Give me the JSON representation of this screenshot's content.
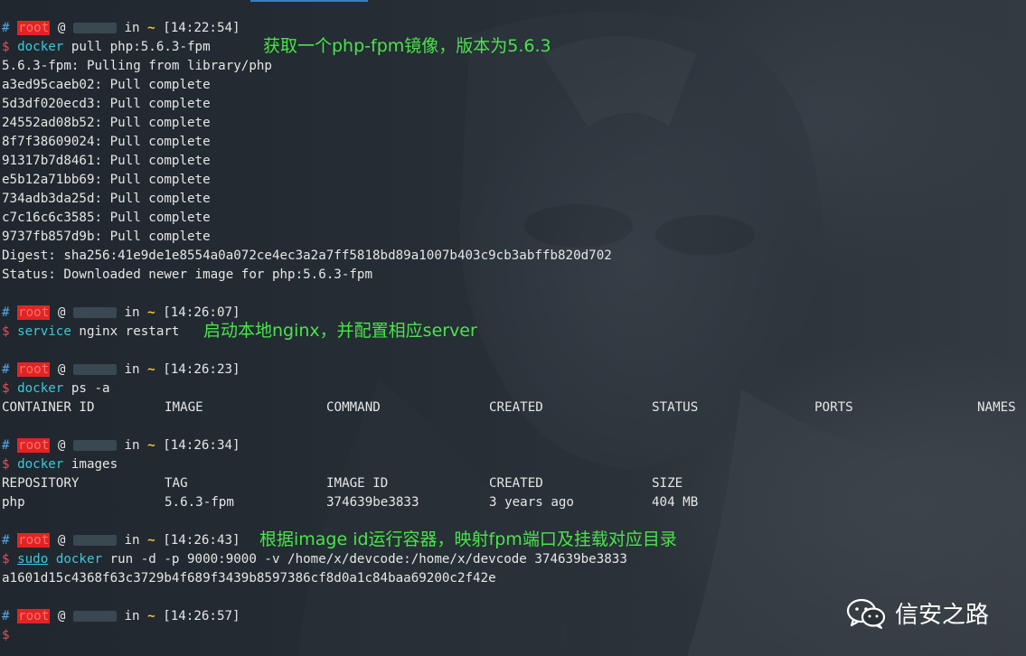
{
  "prompts": [
    {
      "user": "root",
      "time": "[14:22:54]"
    },
    {
      "user": "root",
      "time": "[14:26:07]"
    },
    {
      "user": "root",
      "time": "[14:26:23]"
    },
    {
      "user": "root",
      "time": "[14:26:34]"
    },
    {
      "user": "root",
      "time": "[14:26:43]"
    },
    {
      "user": "root",
      "time": "[14:26:57]"
    }
  ],
  "cmd1": {
    "cmd": "docker",
    "args": " pull php:5.6.3-fpm",
    "annotation": "获取一个php-fpm镜像，版本为5.6.3"
  },
  "pull_output": [
    "5.6.3-fpm: Pulling from library/php",
    "a3ed95caeb02: Pull complete",
    "5d3df020ecd3: Pull complete",
    "24552ad08b52: Pull complete",
    "8f7f38609024: Pull complete",
    "91317b7d8461: Pull complete",
    "e5b12a71bb69: Pull complete",
    "734adb3da25d: Pull complete",
    "c7c16c6c3585: Pull complete",
    "9737fb857d9b: Pull complete",
    "Digest: sha256:41e9de1e8554a0a072ce4ec3a2a7ff5818bd89a1007b403c9cb3abffb820d702",
    "Status: Downloaded newer image for php:5.6.3-fpm"
  ],
  "cmd2": {
    "cmd": "service",
    "args": " nginx restart",
    "annotation": "启动本地nginx，并配置相应server"
  },
  "cmd3": {
    "cmd": "docker",
    "args": " ps -a"
  },
  "ps_headers": [
    "CONTAINER ID",
    "IMAGE",
    "COMMAND",
    "CREATED",
    "STATUS",
    "PORTS",
    "NAMES"
  ],
  "cmd4": {
    "cmd": "docker",
    "args": " images"
  },
  "images_headers": [
    "REPOSITORY",
    "TAG",
    "IMAGE ID",
    "CREATED",
    "SIZE"
  ],
  "images_rows": [
    [
      "php",
      "5.6.3-fpm",
      "374639be3833",
      "3 years ago",
      "404 MB"
    ]
  ],
  "cmd5": {
    "sudo": "sudo",
    "cmd": "docker",
    "args": " run -d -p 9000:9000 -v /home/x/devcode:/home/x/devcode 374639be3833",
    "annotation": "根据image id运行容器，映射fpm端口及挂载对应目录"
  },
  "run_output": "a1601d15c4368f63c3729b4f689f3439b8597386cf8d0a1c84baa69200c2f42e",
  "prompt_symbols": {
    "hash": "#",
    "at": "@",
    "in": "in",
    "tilde": "~",
    "dollar": "$"
  },
  "watermark": {
    "icon": "wechat-icon",
    "text": "信安之路"
  },
  "colors": {
    "background": "#232b33",
    "prompt_user_bg": "#e02424",
    "command": "#3ec8d8",
    "annotation": "#4be34b",
    "tilde": "#f3c43a",
    "hash": "#55a6e6",
    "dollar": "#e55050"
  }
}
